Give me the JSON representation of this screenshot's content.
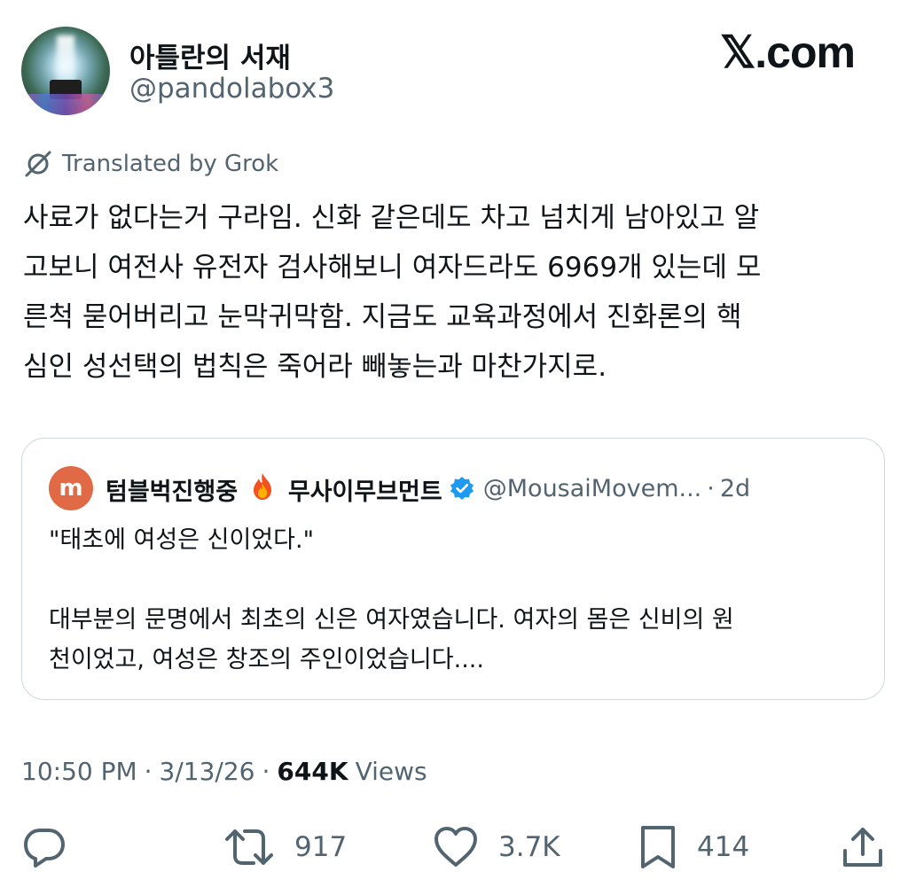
{
  "author": {
    "display_name": "아틀란의 서재",
    "handle": "@pandolabox3"
  },
  "brand": "𝕏.com",
  "translated_label": "Translated by Grok",
  "tweet_text": "사료가 없다는거 구라임. 신화 같은데도 차고 넘치게 남아있고 알\n고보니 여전사 유전자 검사해보니 여자드라도 6969개 있는데 모\n른척 묻어버리고 눈막귀막함. 지금도 교육과정에서 진화론의 핵\n심인 성선택의 법칙은 죽어라 빼놓는과 마찬가지로.",
  "quote": {
    "avatar_letter": "m",
    "display_name_part1": "텀블벅진행중",
    "display_name_part2": "무사이무브먼트",
    "handle": "@MousaiMovem...",
    "separator": "·",
    "time": "2d",
    "text": "\"태초에 여성은 신이었다.\"\n\n대부분의 문명에서 최초의 신은 여자였습니다. 여자의 몸은 신비의 원\n천이었고, 여성은 창조의 주인이었습니다...."
  },
  "meta": {
    "time": "10:50 PM",
    "separator": "·",
    "date": "3/13/26",
    "views_count": "644K",
    "views_label": "Views"
  },
  "actions": {
    "reply_icon": "reply-icon",
    "retweet_icon": "retweet-icon",
    "retweets": "917",
    "like_icon": "heart-icon",
    "likes": "3.7K",
    "bookmark_icon": "bookmark-icon",
    "bookmarks": "414",
    "share_icon": "share-icon"
  },
  "colors": {
    "text": "#0f1419",
    "secondary": "#536471",
    "border": "#cfd9de",
    "verified": "#1d9bf0",
    "quote_avatar": "#e06a45"
  }
}
